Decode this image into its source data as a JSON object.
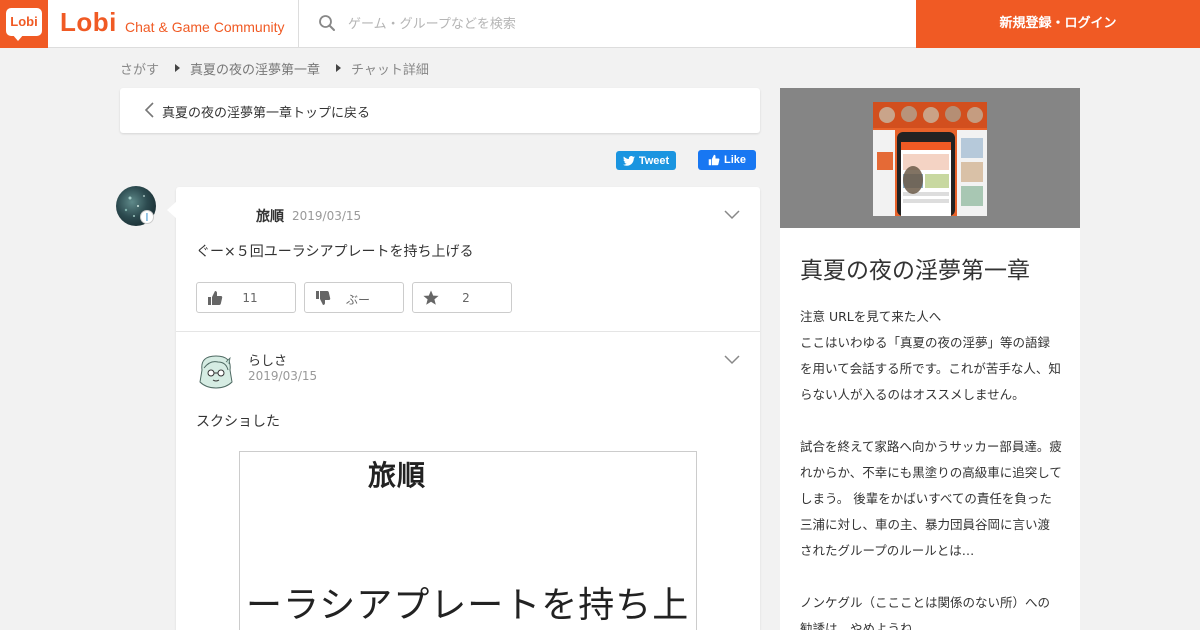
{
  "header": {
    "logo_text": "Lobi",
    "brand": "Lobi",
    "tagline": "Chat & Game Community",
    "search_placeholder": "ゲーム・グループなどを検索",
    "login_label": "新規登録・ログイン"
  },
  "colors": {
    "brand": "#f05a24",
    "twitter": "#1b95e0",
    "facebook": "#1877f2",
    "hero_bg": "#858585"
  },
  "breadcrumb": [
    "さがす",
    "真夏の夜の淫夢第一章",
    "チャット詳細"
  ],
  "back_label": "真夏の夜の淫夢第一章トップに戻る",
  "social": {
    "tweet_label": "Tweet",
    "like_label": "Like"
  },
  "messages": [
    {
      "name": "旅順",
      "date": "2019/03/15",
      "text": "ぐー×５回ユーラシアプレートを持ち上げる",
      "reactions": [
        {
          "icon": "thumbs-up-icon",
          "label": "11"
        },
        {
          "icon": "thumbs-down-icon",
          "label": "ぶー"
        },
        {
          "icon": "star-icon",
          "label": "2"
        }
      ]
    },
    {
      "name": "らしさ",
      "date": "2019/03/15",
      "text": "スクショした",
      "image_text": [
        "旅順",
        "ーラシアプレートを持ち上"
      ]
    }
  ],
  "sidebar": {
    "title": "真夏の夜の淫夢第一章",
    "description": "注意 URLを見て来た人へ\nここはいわゆる「真夏の夜の淫夢」等の語録を用いて会話する所です。これが苦手な人、知らない人が入るのはオススメしません。\n\n試合を終えて家路へ向かうサッカー部員達。疲れからか、不幸にも黒塗りの高級車に追突してしまう。 後輩をかばいすべての責任を負った三浦に対し、車の主、暴力団員谷岡に言い渡されたグループのルールとは…\n\nノンケグル（ここことは関係のない所）への勧誘は…やめようね"
  }
}
